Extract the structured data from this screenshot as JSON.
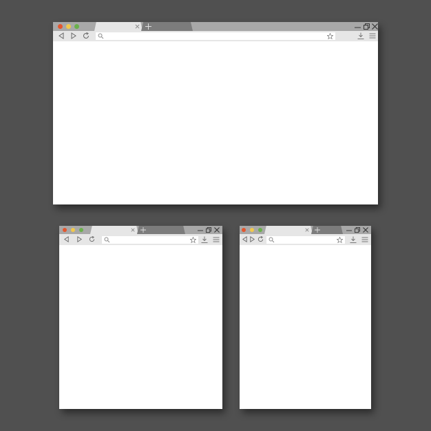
{
  "background_color": "#505050",
  "colors": {
    "traffic_close": "#e4572e",
    "traffic_minimize": "#f2c94c",
    "traffic_maximize": "#6ab04c",
    "titlebar": "#a8a8a8",
    "toolbar": "#e6e6e6",
    "inactive_tab": "#7c7c7c",
    "content": "#ffffff"
  },
  "windows": [
    {
      "label": "large",
      "tabs": [
        {
          "state": "active",
          "title": ""
        },
        {
          "state": "inactive",
          "title": ""
        }
      ],
      "icons": {
        "tab_close": "close-icon",
        "new_tab": "plus-icon",
        "back": "back-icon",
        "forward": "forward-icon",
        "reload": "reload-icon",
        "search": "search-icon",
        "bookmark": "star-icon",
        "download": "download-icon",
        "menu": "menu-icon",
        "window_minimize": "minimize-icon",
        "window_restore": "restore-icon",
        "window_close": "close-icon"
      },
      "address_bar": {
        "value": "",
        "placeholder": ""
      }
    },
    {
      "label": "medium",
      "tabs": [
        {
          "state": "active",
          "title": ""
        },
        {
          "state": "inactive",
          "title": ""
        }
      ],
      "address_bar": {
        "value": "",
        "placeholder": ""
      }
    },
    {
      "label": "small",
      "tabs": [
        {
          "state": "active",
          "title": ""
        },
        {
          "state": "inactive",
          "title": ""
        }
      ],
      "address_bar": {
        "value": "",
        "placeholder": ""
      }
    }
  ]
}
